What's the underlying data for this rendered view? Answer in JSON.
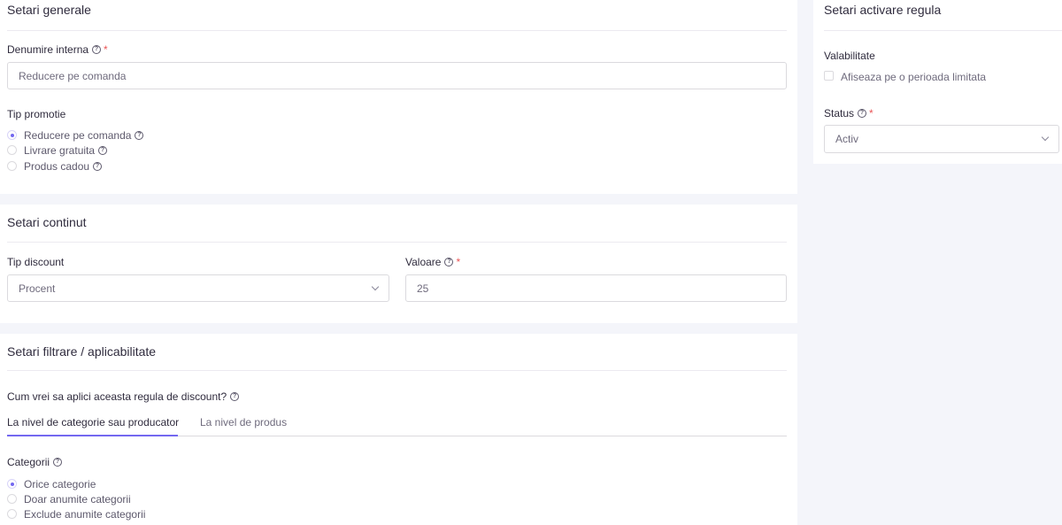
{
  "general": {
    "title": "Setari generale",
    "internal_name_label": "Denumire interna",
    "internal_name_value": "Reducere pe comanda",
    "promo_type_label": "Tip promotie",
    "promo_types": [
      {
        "label": "Reducere pe comanda",
        "selected": true
      },
      {
        "label": "Livrare gratuita",
        "selected": false
      },
      {
        "label": "Produs cadou",
        "selected": false
      }
    ]
  },
  "content": {
    "title": "Setari continut",
    "discount_type_label": "Tip discount",
    "discount_type_value": "Procent",
    "value_label": "Valoare",
    "value_value": "25"
  },
  "filter": {
    "title": "Setari filtrare / aplicabilitate",
    "question": "Cum vrei sa aplici aceasta regula de discount?",
    "tabs": [
      {
        "label": "La nivel de categorie sau producator",
        "active": true
      },
      {
        "label": "La nivel de produs",
        "active": false
      }
    ],
    "categories_label": "Categorii",
    "category_options": [
      {
        "label": "Orice categorie",
        "selected": true
      },
      {
        "label": "Doar anumite categorii",
        "selected": false
      },
      {
        "label": "Exclude anumite categorii",
        "selected": false
      }
    ]
  },
  "activation": {
    "title": "Setari activare regula",
    "validity_label": "Valabilitate",
    "limited_period_label": "Afiseaza pe o perioada limitata",
    "limited_period_checked": false,
    "status_label": "Status",
    "status_value": "Activ"
  },
  "required_mark": "*",
  "help_glyph": "?",
  "colors": {
    "accent": "#7367f0",
    "required": "#ea5455",
    "background": "#f4f5fa",
    "card": "#ffffff"
  }
}
